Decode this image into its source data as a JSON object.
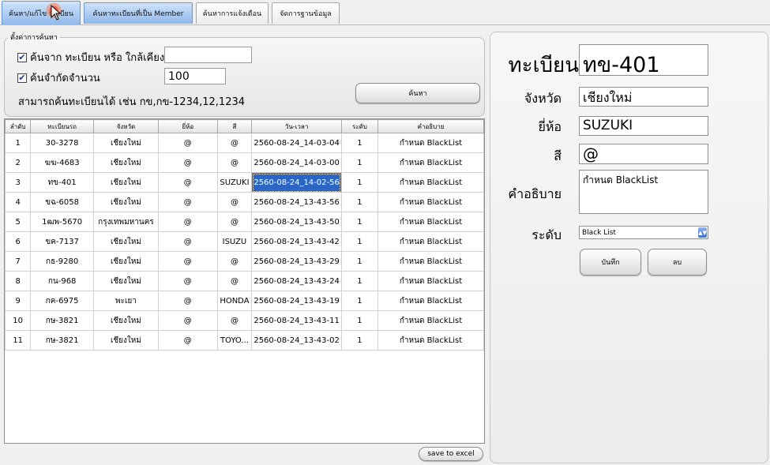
{
  "tabs": [
    {
      "label": "ค้นหา/แก้ไข ทะเบียน"
    },
    {
      "label": "ค้นหาทะเบียนที่เป็น Member"
    },
    {
      "label": "ค้นหาการแจ้งเตือน"
    },
    {
      "label": "จัดการฐานข้อมูล"
    }
  ],
  "search": {
    "legend": "ตั้งค่าการค้นหา",
    "opt1_label": "ค้นจาก ทะเบียน หรือ ใกล้เคียง",
    "opt1_checked": true,
    "opt1_value": "",
    "opt2_label": "ค้นจำกัดจำนวน",
    "opt2_checked": true,
    "opt2_value": "100",
    "hint": "สามารถค้นทะเบียนได้ เช่น กข,กข-1234,12,1234",
    "button": "ค้นหา"
  },
  "table": {
    "columns": [
      "ลำดับ",
      "ทะเบียนรถ",
      "จังหวัด",
      "ยี่ห้อ",
      "สี",
      "วัน-เวลา",
      "ระดับ",
      "คำอธิบาย"
    ],
    "selected_row": 2,
    "selected_col": 5,
    "rows": [
      [
        "1",
        "30-3278",
        "เชียงใหม่",
        "@",
        "@",
        "2560-08-24_14-03-04",
        "1",
        "กำหนด BlackList"
      ],
      [
        "2",
        "ฆฆ-4683",
        "เชียงใหม่",
        "@",
        "@",
        "2560-08-24_14-03-00",
        "1",
        "กำหนด BlackList"
      ],
      [
        "3",
        "ทข-401",
        "เชียงใหม่",
        "@",
        "SUZUKI",
        "2560-08-24_14-02-56",
        "1",
        "กำหนด BlackList"
      ],
      [
        "4",
        "ขฉ-6058",
        "เชียงใหม่",
        "@",
        "@",
        "2560-08-24_13-43-56",
        "1",
        "กำหนด BlackList"
      ],
      [
        "5",
        "1ฒพ-5670",
        "กรุงเทพมหานคร",
        "@",
        "@",
        "2560-08-24_13-43-50",
        "1",
        "กำหนด BlackList"
      ],
      [
        "6",
        "ขค-7137",
        "เชียงใหม่",
        "@",
        "ISUZU",
        "2560-08-24_13-43-42",
        "1",
        "กำหนด BlackList"
      ],
      [
        "7",
        "กธ-9280",
        "เชียงใหม่",
        "@",
        "@",
        "2560-08-24_13-43-29",
        "1",
        "กำหนด BlackList"
      ],
      [
        "8",
        "กน-968",
        "เชียงใหม่",
        "@",
        "@",
        "2560-08-24_13-43-24",
        "1",
        "กำหนด BlackList"
      ],
      [
        "9",
        "กค-6975",
        "พะเยา",
        "@",
        "HONDA",
        "2560-08-24_13-43-19",
        "1",
        "กำหนด BlackList"
      ],
      [
        "10",
        "กษ-3821",
        "เชียงใหม่",
        "@",
        "@",
        "2560-08-24_13-43-11",
        "1",
        "กำหนด BlackList"
      ],
      [
        "11",
        "กษ-3821",
        "เชียงใหม่",
        "@",
        "TOYO...",
        "2560-08-24_13-43-02",
        "1",
        "กำหนด BlackList"
      ]
    ]
  },
  "save_excel": "save to excel",
  "detail": {
    "plate_label": "ทะเบียน",
    "plate_value": "ทข-401",
    "province_label": "จังหวัด",
    "province_value": "เชียงใหม่",
    "brand_label": "ยี่ห้อ",
    "brand_value": "SUZUKI",
    "color_label": "สี",
    "color_value": "@",
    "desc_label": "คำอธิบาย",
    "desc_value": "กำหนด BlackList",
    "level_label": "ระดับ",
    "level_value": "Black List",
    "save_button": "บันทึก",
    "delete_button": "ลบ"
  },
  "colors": {
    "selection": "#2c66c4",
    "tab_active": "#8fb8ea"
  }
}
